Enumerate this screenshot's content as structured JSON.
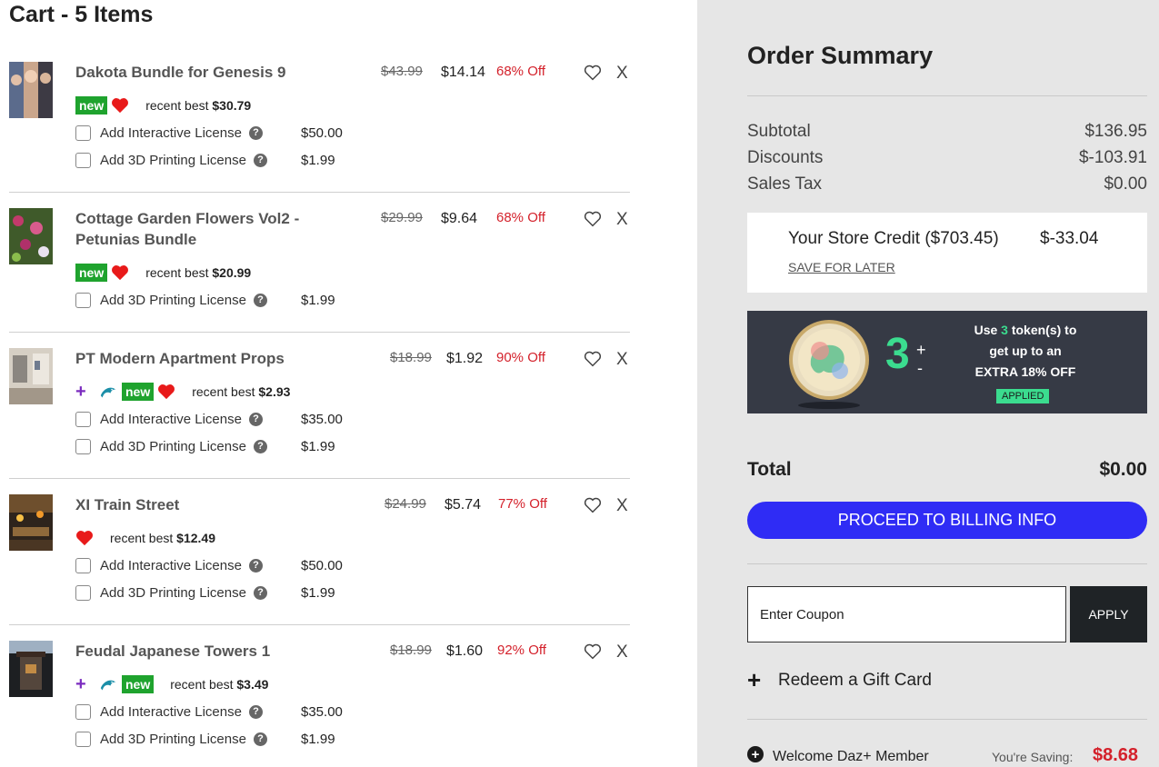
{
  "cart": {
    "title": "Cart - 5 Items",
    "items": [
      {
        "name": "Dakota Bundle for Genesis 9",
        "original_price": "$43.99",
        "price": "$14.14",
        "discount": "68% Off",
        "badges": [
          "new",
          "heart"
        ],
        "recent_best_label": "recent best",
        "recent_best": "$30.79",
        "licenses": [
          {
            "label": "Add Interactive License",
            "price": "$50.00"
          },
          {
            "label": "Add 3D Printing License",
            "price": "$1.99"
          }
        ],
        "remove_label": "X"
      },
      {
        "name": "Cottage Garden Flowers Vol2 - Petunias Bundle",
        "original_price": "$29.99",
        "price": "$9.64",
        "discount": "68% Off",
        "badges": [
          "new",
          "heart"
        ],
        "recent_best_label": "recent best",
        "recent_best": "$20.99",
        "licenses": [
          {
            "label": "Add 3D Printing License",
            "price": "$1.99"
          }
        ],
        "remove_label": "X"
      },
      {
        "name": "PT Modern Apartment Props",
        "original_price": "$18.99",
        "price": "$1.92",
        "discount": "90% Off",
        "badges": [
          "plus",
          "dolphin",
          "new",
          "heart"
        ],
        "recent_best_label": "recent best",
        "recent_best": "$2.93",
        "licenses": [
          {
            "label": "Add Interactive License",
            "price": "$35.00"
          },
          {
            "label": "Add 3D Printing License",
            "price": "$1.99"
          }
        ],
        "remove_label": "X"
      },
      {
        "name": "XI Train Street",
        "original_price": "$24.99",
        "price": "$5.74",
        "discount": "77% Off",
        "badges": [
          "heart"
        ],
        "recent_best_label": "recent best",
        "recent_best": "$12.49",
        "licenses": [
          {
            "label": "Add Interactive License",
            "price": "$50.00"
          },
          {
            "label": "Add 3D Printing License",
            "price": "$1.99"
          }
        ],
        "remove_label": "X"
      },
      {
        "name": "Feudal Japanese Towers 1",
        "original_price": "$18.99",
        "price": "$1.60",
        "discount": "92% Off",
        "badges": [
          "plus",
          "dolphin",
          "new"
        ],
        "recent_best_label": "recent best",
        "recent_best": "$3.49",
        "licenses": [
          {
            "label": "Add Interactive License",
            "price": "$35.00"
          },
          {
            "label": "Add 3D Printing License",
            "price": "$1.99"
          }
        ],
        "remove_label": "X"
      }
    ],
    "new_badge_label": "new",
    "plus_symbol": "+"
  },
  "summary": {
    "title": "Order Summary",
    "subtotal_label": "Subtotal",
    "subtotal": "$136.95",
    "discounts_label": "Discounts",
    "discounts": "$-103.91",
    "tax_label": "Sales Tax",
    "tax": "$0.00",
    "store_credit_label": "Your Store Credit ($703.45)",
    "store_credit_amount": "$-33.04",
    "save_for_later": "SAVE FOR LATER",
    "tokens": {
      "count": "3",
      "plus": "+",
      "minus": "-",
      "line1_prefix": "Use",
      "line1_count": "3",
      "line1_suffix": "token(s) to",
      "line2": "get up to an",
      "line3": "EXTRA 18% OFF",
      "applied": "APPLIED"
    },
    "total_label": "Total",
    "total": "$0.00",
    "billing_button": "PROCEED TO BILLING INFO",
    "coupon_placeholder": "Enter Coupon",
    "apply_button": "APPLY",
    "gift_plus": "+",
    "gift_card_label": "Redeem a Gift Card",
    "member_icon": "+",
    "member_label": "Welcome Daz+ Member",
    "saving_label": "You're Saving:",
    "saving_amount": "$8.68"
  },
  "colors": {
    "accent_blue": "#2f2cf5",
    "discount_red": "#d4212b",
    "new_green": "#1fa32e",
    "token_green": "#3bdc8f",
    "panel_gray": "#e6e6e6",
    "token_bg": "#363a45"
  }
}
